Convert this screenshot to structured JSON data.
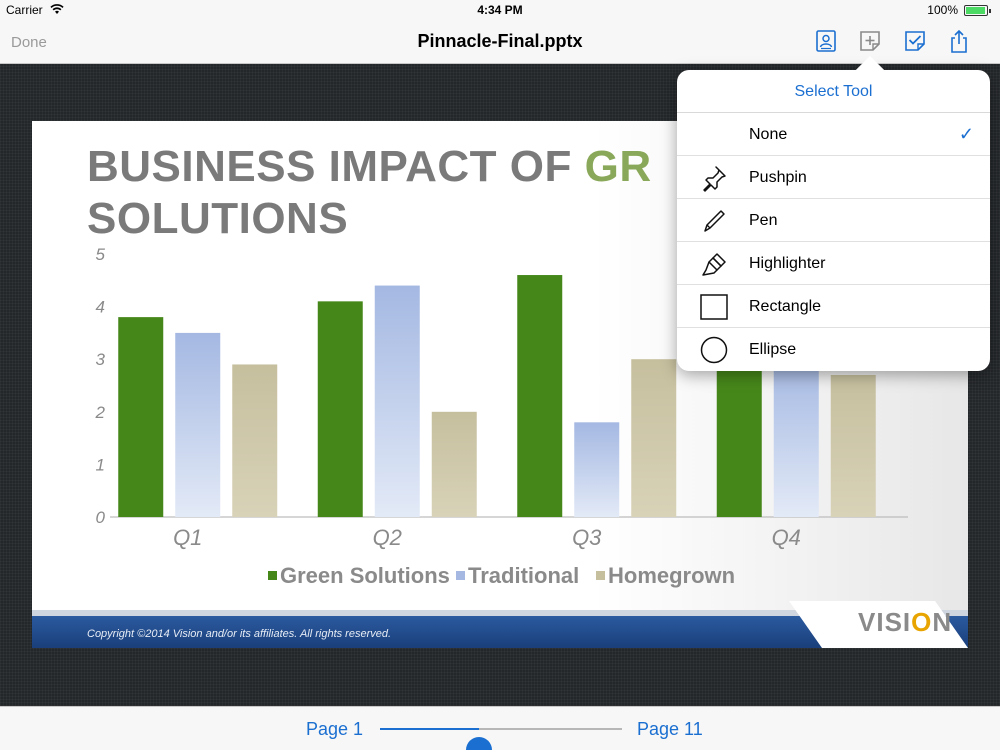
{
  "status_bar": {
    "carrier": "Carrier",
    "time": "4:34 PM",
    "battery": "100%"
  },
  "nav_bar": {
    "done_label": "Done",
    "title": "Pinnacle-Final.pptx",
    "toolbar_icons": [
      "contact-card-icon",
      "add-annotation-icon",
      "checkbox-icon",
      "share-icon"
    ]
  },
  "slide": {
    "headline_part1": "BUSINESS IMPACT OF ",
    "headline_part2": "GR",
    "headline_line2": "SOLUTIONS",
    "copyright": "Copyright ©2014 Vision and/or its affiliates. All rights reserved.",
    "logo_text_a": "VISI",
    "logo_text_b": "O",
    "logo_text_c": "N"
  },
  "chart_data": {
    "type": "bar",
    "categories": [
      "Q1",
      "Q2",
      "Q3",
      "Q4"
    ],
    "series": [
      {
        "name": "Green Solutions",
        "color": "#46871a",
        "values": [
          3.8,
          4.1,
          4.6,
          3.0
        ]
      },
      {
        "name": "Traditional",
        "color": "#a4b8e2",
        "values": [
          3.5,
          4.4,
          1.8,
          3.0
        ]
      },
      {
        "name": "Homegrown",
        "color": "#c6bf9e",
        "values": [
          2.9,
          2.0,
          3.0,
          2.7
        ]
      }
    ],
    "yticks": [
      "0",
      "1",
      "2",
      "3",
      "4",
      "5"
    ],
    "ylim": [
      0,
      5
    ],
    "legend_position": "bottom",
    "grid": false
  },
  "popover": {
    "title": "Select Tool",
    "items": [
      {
        "label": "None",
        "icon": "",
        "selected": true
      },
      {
        "label": "Pushpin",
        "icon": "pushpin-icon",
        "selected": false
      },
      {
        "label": "Pen",
        "icon": "pen-icon",
        "selected": false
      },
      {
        "label": "Highlighter",
        "icon": "highlighter-icon",
        "selected": false
      },
      {
        "label": "Rectangle",
        "icon": "rectangle-icon",
        "selected": false
      },
      {
        "label": "Ellipse",
        "icon": "ellipse-icon",
        "selected": false
      }
    ],
    "check_glyph": "✓"
  },
  "page_nav": {
    "first_label": "Page 1",
    "last_label": "Page 11",
    "position_fraction": 0.41
  },
  "colors": {
    "accent": "#1b6fd1",
    "headline_gray": "#7a7a7a",
    "headline_green": "#8aa85a"
  }
}
